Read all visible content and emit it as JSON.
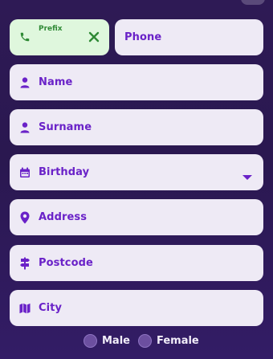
{
  "phone_prefix": {
    "label": "Prefix",
    "accent": "#2f8a35",
    "icon": "phone-icon",
    "clear_icon": "close-icon"
  },
  "phone": {
    "placeholder": "Phone"
  },
  "fields": {
    "name": {
      "placeholder": "Name",
      "icon": "person-icon"
    },
    "surname": {
      "placeholder": "Surname",
      "icon": "person-icon"
    },
    "birthday": {
      "placeholder": "Birthday",
      "icon": "calendar-icon"
    },
    "address": {
      "placeholder": "Address",
      "icon": "map-pin-icon"
    },
    "postcode": {
      "placeholder": "Postcode",
      "icon": "signpost-icon"
    },
    "city": {
      "placeholder": "City",
      "icon": "map-icon"
    }
  },
  "gender": {
    "options": [
      "Male",
      "Female"
    ]
  },
  "colors": {
    "field_text": "#6a22c8",
    "field_bg": "#eeeaf5",
    "prefix_bg": "#dff7dd"
  }
}
